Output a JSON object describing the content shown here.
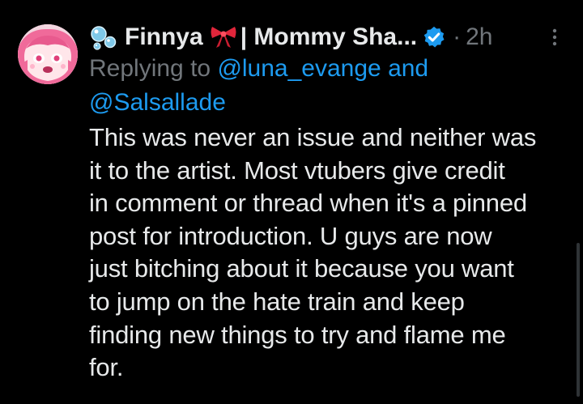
{
  "tweet": {
    "display_name": "Finnya",
    "display_name_rest": "| Mommy Sha...",
    "separator": "·",
    "time": "2h",
    "replying_prefix": "Replying to",
    "mention_1": "@luna_evange",
    "replying_joiner": "and",
    "mention_2": "@Salsallade",
    "body_lines": [
      "This was never an issue and neither was",
      "it to the artist. Most vtubers give credit",
      "in comment or thread when it's a pinned",
      "post for introduction. U guys are now",
      "just bitching about it because you want",
      "to jump on the hate train and keep",
      "finding new things to try and flame me",
      "for."
    ]
  },
  "icons": {
    "name_prefix": "bubbles-icon",
    "name_emoji": "ribbon-bow-icon",
    "verified": "verified-badge-icon",
    "more": "more-options-icon"
  },
  "colors": {
    "background": "#000000",
    "text": "#e7e9ea",
    "secondary": "#71767b",
    "link": "#1d9bf0"
  }
}
